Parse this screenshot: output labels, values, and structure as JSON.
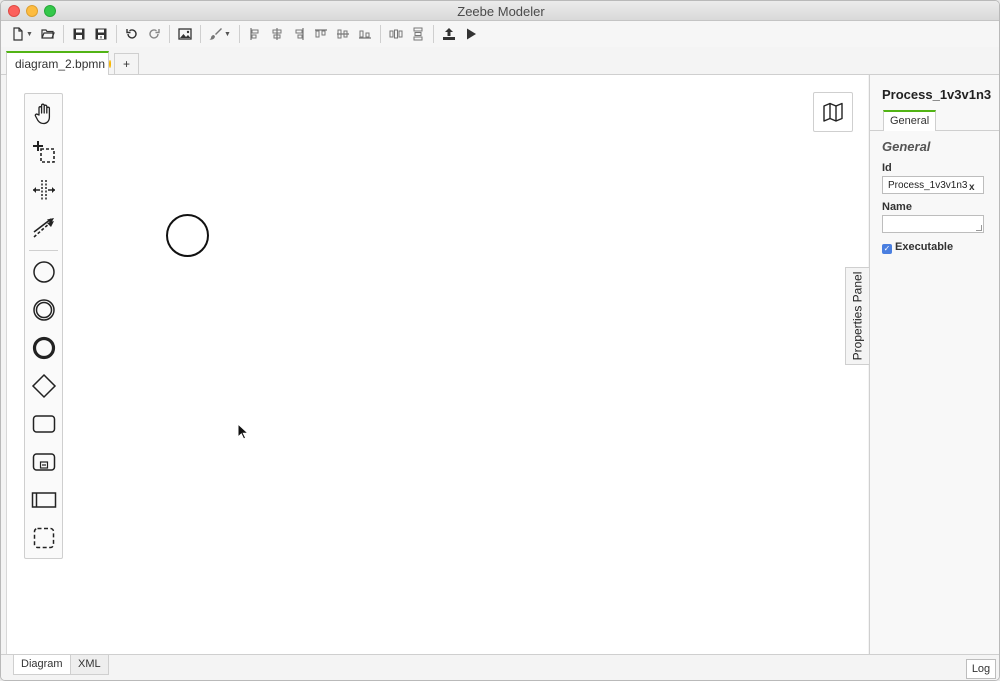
{
  "window": {
    "title": "Zeebe Modeler"
  },
  "toolbar": {
    "items": [
      "new-file",
      "open-file",
      "save",
      "save-as",
      "undo",
      "redo",
      "export-image",
      "color-brush",
      "align-left",
      "align-center",
      "align-right",
      "align-top",
      "align-middle",
      "align-bottom",
      "distribute-horizontal",
      "distribute-vertical",
      "deploy",
      "start-instance"
    ]
  },
  "tabs": [
    {
      "label": "diagram_2.bpmn",
      "dirty": true
    }
  ],
  "tab_add_label": "+",
  "palette": {
    "tools": [
      "hand-tool",
      "lasso-tool",
      "space-tool",
      "global-connect-tool",
      "start-event",
      "intermediate-event",
      "end-event",
      "gateway",
      "task",
      "subprocess",
      "pool",
      "group"
    ]
  },
  "properties": {
    "title": "Process_1v3v1n3",
    "tab": "General",
    "group": "General",
    "id_label": "Id",
    "id_value": "Process_1v3v1n3",
    "clear_label": "x",
    "name_label": "Name",
    "name_value": "",
    "executable_label": "Executable",
    "executable_checked": true,
    "checkmark": "✓",
    "toggle_label": "Properties Panel"
  },
  "bottom": {
    "tabs": [
      "Diagram",
      "XML"
    ],
    "active": "Diagram",
    "log_label": "Log"
  },
  "colors": {
    "accent": "#52b415",
    "dirty": "#f7b500",
    "checkbox": "#4a7fe0"
  }
}
